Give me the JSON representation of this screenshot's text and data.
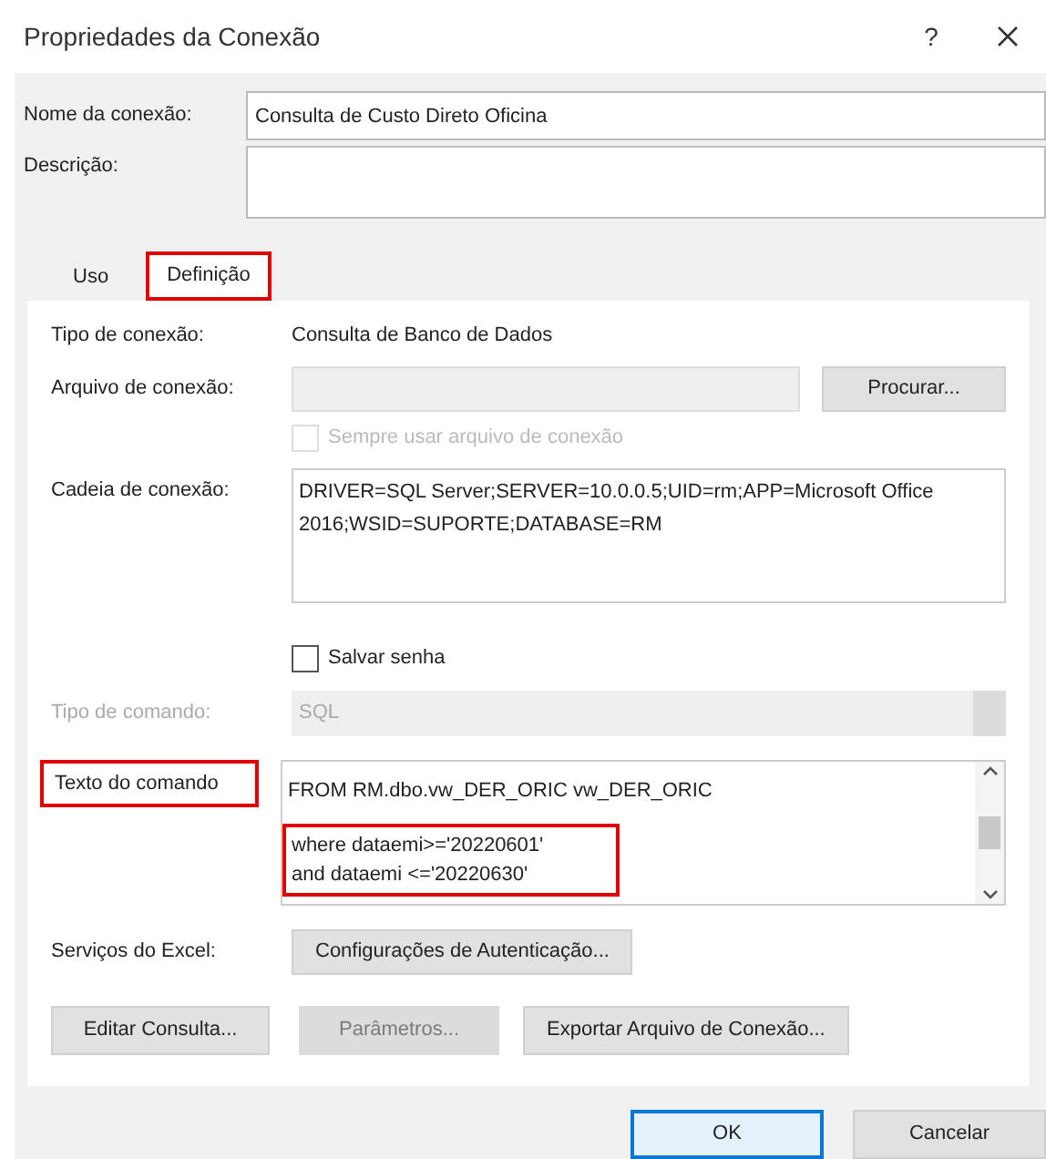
{
  "window": {
    "title": "Propriedades da Conexão",
    "help": "?"
  },
  "connection_name": {
    "label": "Nome da conexão:",
    "value": "Consulta de Custo Direto Oficina"
  },
  "description": {
    "label": "Descrição:"
  },
  "tabs": [
    {
      "label": "Uso",
      "selected": false,
      "highlighted": false
    },
    {
      "label": "Definição",
      "selected": true,
      "highlighted": true
    }
  ],
  "definition": {
    "connection_type": {
      "label": "Tipo de conexão:",
      "value": "Consulta de Banco de Dados"
    },
    "connection_file": {
      "label": "Arquivo de conexão:",
      "button": "Procurar..."
    },
    "always_use_file": {
      "label": "Sempre usar arquivo de conexão",
      "checked": false,
      "disabled": true
    },
    "connection_string": {
      "label": "Cadeia de conexão:",
      "lines": [
        "DRIVER=SQL Server;SERVER=10.0.0.5;UID=rm;APP=Microsoft Office",
        "2016;WSID=SUPORTE;DATABASE=RM"
      ]
    },
    "save_password": {
      "label": "Salvar senha",
      "checked": false,
      "disabled": false
    },
    "command_type": {
      "label": "Tipo de comando:",
      "value": "SQL",
      "disabled": true
    },
    "command_text": {
      "label": "Texto do comando",
      "label_highlighted": true,
      "lines": [
        {
          "text": "FROM RM.dbo.vw_DER_ORIC vw_DER_ORIC",
          "highlighted": false
        },
        {
          "text": "where dataemi>='20220601'",
          "highlighted": true
        },
        {
          "text": "and dataemi <='20220630'",
          "highlighted": true
        }
      ]
    },
    "excel_services": {
      "label": "Serviços do Excel:",
      "button": "Configurações de Autenticação..."
    },
    "buttons": [
      {
        "label": "Editar Consulta...",
        "disabled": false
      },
      {
        "label": "Parâmetros...",
        "disabled": true
      },
      {
        "label": "Exportar Arquivo de Conexão...",
        "disabled": false
      }
    ]
  },
  "footer_buttons": [
    {
      "label": "OK",
      "default": true
    },
    {
      "label": "Cancelar",
      "default": false
    }
  ]
}
